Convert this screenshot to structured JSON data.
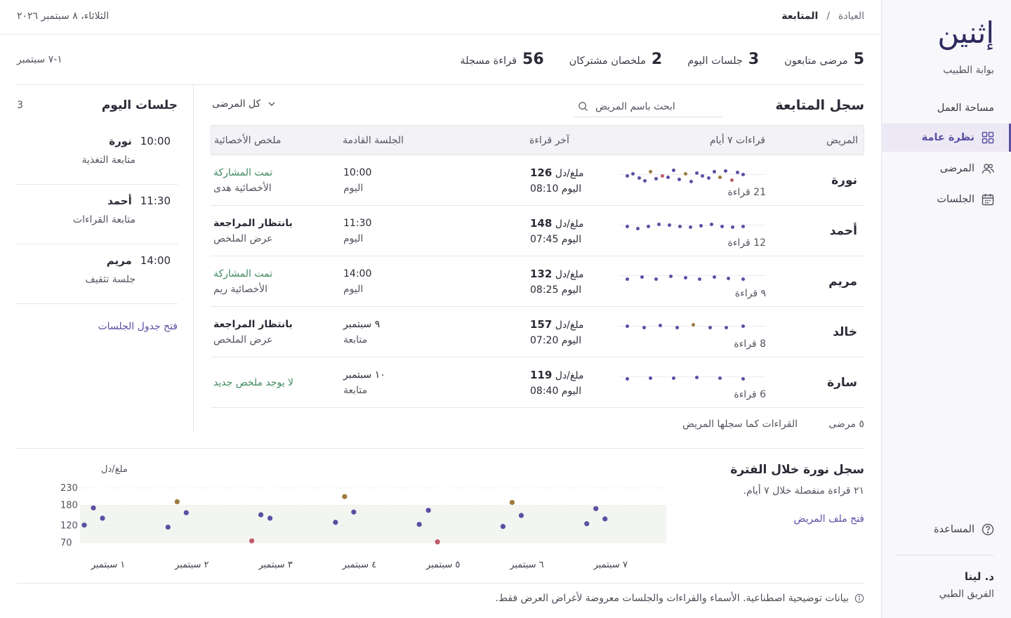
{
  "sidebar": {
    "logo": "إثنين",
    "portal": "بوابة الطبيب",
    "items": [
      {
        "label": "مساحة العمل",
        "icon": ""
      },
      {
        "label": "نظرة عامة",
        "icon": "grid-icon"
      },
      {
        "label": "المرضى",
        "icon": "users-icon"
      },
      {
        "label": "الجلسات",
        "icon": "calendar-icon"
      }
    ],
    "help": "المساعدة",
    "user_name": "د. لينا",
    "user_team": "الفريق الطبي"
  },
  "topbar": {
    "crumb_root": "العيادة",
    "crumb_sep": "/",
    "crumb_current": "المتابعة",
    "date": "الثلاثاء، ٨ سبتمبر ٢٠٢٦"
  },
  "stats": [
    {
      "n": "5",
      "label": "مرضى متابعون"
    },
    {
      "n": "3",
      "label": "جلسات اليوم"
    },
    {
      "n": "2",
      "label": "ملخصان مشتركان"
    },
    {
      "n": "56",
      "label": "قراءة مسجلة"
    }
  ],
  "range": "١-٧ سبتمبر",
  "log": {
    "title": "سجل المتابعة",
    "search_placeholder": "ابحث باسم المريض",
    "filter": "كل المرضى",
    "headers": [
      "المريض",
      "قراءات ٧ أيام",
      "آخر قراءة",
      "الجلسة القادمة",
      "ملخص الأخصائية"
    ],
    "rows": [
      {
        "name": "نورة",
        "count": "21 قراءة",
        "last_val": "126",
        "unit": "ملغ/دل",
        "last_time": "اليوم 08:10",
        "next_a": "10:00",
        "next_b": "اليوم",
        "sum_a": "تمت المشاركة",
        "sum_b": "الأخصائية هدى",
        "sum_status": "shared",
        "spark": [
          148,
          160,
          138,
          126,
          170,
          134,
          150,
          142,
          176,
          132,
          158,
          122,
          162,
          150,
          138,
          168,
          142,
          172,
          130,
          166,
          156
        ],
        "spark_colors": [
          "#5b4fa3",
          "#5b4fa3",
          "#5b4fa3",
          "#5b4fa3",
          "#9b7a3e",
          "#5b4fa3",
          "#c05a6a",
          "#5b4fa3",
          "#5b4fa3",
          "#5b4fa3",
          "#9b7a3e",
          "#5b4fa3",
          "#5b4fa3",
          "#5b4fa3",
          "#5b4fa3",
          "#5b4fa3",
          "#9b7a3e",
          "#5b4fa3",
          "#c05a6a",
          "#5b4fa3",
          "#5b4fa3"
        ]
      },
      {
        "name": "أحمد",
        "count": "12 قراءة",
        "last_val": "148",
        "unit": "ملغ/دل",
        "last_time": "اليوم 07:45",
        "next_a": "11:30",
        "next_b": "اليوم",
        "sum_a": "بانتظار المراجعة",
        "sum_b": "عرض الملخص",
        "sum_status": "pending",
        "spark": [
          150,
          140,
          150,
          160,
          155,
          148,
          145,
          152,
          160,
          150,
          145,
          150
        ],
        "spark_colors": [
          "#5b4fa3",
          "#5b4fa3",
          "#5b4fa3",
          "#5b4fa3",
          "#5b4fa3",
          "#5b4fa3",
          "#5b4fa3",
          "#5b4fa3",
          "#5b4fa3",
          "#5b4fa3",
          "#5b4fa3",
          "#5b4fa3"
        ]
      },
      {
        "name": "مريم",
        "count": "٩ قراءة",
        "last_val": "132",
        "unit": "ملغ/دل",
        "last_time": "اليوم 08:25",
        "next_a": "14:00",
        "next_b": "اليوم",
        "sum_a": "تمت المشاركة",
        "sum_b": "الأخصائية ريم",
        "sum_status": "shared",
        "spark": [
          140,
          150,
          140,
          152,
          145,
          140,
          148,
          142,
          140
        ],
        "spark_colors": [
          "#5b4fa3",
          "#5b4fa3",
          "#5b4fa3",
          "#5b4fa3",
          "#5b4fa3",
          "#5b4fa3",
          "#5b4fa3",
          "#5b4fa3",
          "#5b4fa3"
        ]
      },
      {
        "name": "خالد",
        "count": "8 قراءة",
        "last_val": "157",
        "unit": "ملغ/دل",
        "last_time": "اليوم 07:20",
        "next_a": "٩ سبتمبر",
        "next_b": "متابعة",
        "sum_a": "بانتظار المراجعة",
        "sum_b": "عرض الملخص",
        "sum_status": "pending",
        "spark": [
          155,
          148,
          158,
          150,
          162,
          150,
          148,
          155
        ],
        "spark_colors": [
          "#5b4fa3",
          "#5b4fa3",
          "#5b4fa3",
          "#5b4fa3",
          "#9b7a3e",
          "#5b4fa3",
          "#5b4fa3",
          "#5b4fa3"
        ]
      },
      {
        "name": "سارة",
        "count": "6 قراءة",
        "last_val": "119",
        "unit": "ملغ/دل",
        "last_time": "اليوم 08:40",
        "next_a": "١٠ سبتمبر",
        "next_b": "متابعة",
        "sum_a": "لا يوجد ملخص جديد",
        "sum_b": "",
        "sum_status": "none",
        "spark": [
          145,
          150,
          148,
          152,
          150,
          145
        ],
        "spark_colors": [
          "#5b4fa3",
          "#5b4fa3",
          "#5b4fa3",
          "#5b4fa3",
          "#5b4fa3",
          "#5b4fa3"
        ]
      }
    ],
    "footer_count": "٥ مرضى",
    "footer_note": "القراءات كما سجلها المريض"
  },
  "sessions": {
    "title": "جلسات اليوم",
    "count": "3",
    "items": [
      {
        "time": "10:00",
        "name": "نورة",
        "desc": "متابعة التغذية"
      },
      {
        "time": "11:30",
        "name": "أحمد",
        "desc": "متابعة القراءات"
      },
      {
        "time": "14:00",
        "name": "مريم",
        "desc": "جلسة تثقيف"
      }
    ],
    "link": "فتح جدول الجلسات"
  },
  "chart_panel": {
    "title": "سجل نورة خلال الفترة",
    "subtitle": "٢١ قراءة منفصلة خلال ٧ أيام.",
    "link": "فتح ملف المريض",
    "disclaimer": "بيانات توضيحية اصطناعية. الأسماء والقراءات والجلسات معروضة لأغراض العرض فقط."
  },
  "chart_data": {
    "type": "scatter",
    "ylabel": "ملغ/دل",
    "yticks": [
      70,
      120,
      180,
      230
    ],
    "ylim": [
      60,
      240
    ],
    "target_band": [
      70,
      180
    ],
    "categories": [
      "١ سبتمبر",
      "٢ سبتمبر",
      "٣ سبتمبر",
      "٤ سبتمبر",
      "٥ سبتمبر",
      "٦ سبتمبر",
      "٧ سبتمبر"
    ],
    "points": [
      {
        "day": 1,
        "slot": 0,
        "value": 122
      },
      {
        "day": 1,
        "slot": 1,
        "value": 172
      },
      {
        "day": 1,
        "slot": 2,
        "value": 142
      },
      {
        "day": 2,
        "slot": 0,
        "value": 116
      },
      {
        "day": 2,
        "slot": 1,
        "value": 190
      },
      {
        "day": 2,
        "slot": 2,
        "value": 158
      },
      {
        "day": 3,
        "slot": 0,
        "value": 76
      },
      {
        "day": 3,
        "slot": 1,
        "value": 152
      },
      {
        "day": 3,
        "slot": 2,
        "value": 142
      },
      {
        "day": 4,
        "slot": 0,
        "value": 130
      },
      {
        "day": 4,
        "slot": 1,
        "value": 205
      },
      {
        "day": 4,
        "slot": 2,
        "value": 160
      },
      {
        "day": 5,
        "slot": 0,
        "value": 124
      },
      {
        "day": 5,
        "slot": 1,
        "value": 165
      },
      {
        "day": 5,
        "slot": 2,
        "value": 73
      },
      {
        "day": 6,
        "slot": 0,
        "value": 118
      },
      {
        "day": 6,
        "slot": 1,
        "value": 188
      },
      {
        "day": 6,
        "slot": 2,
        "value": 150
      },
      {
        "day": 7,
        "slot": 0,
        "value": 126
      },
      {
        "day": 7,
        "slot": 1,
        "value": 170
      },
      {
        "day": 7,
        "slot": 2,
        "value": 140
      }
    ],
    "colors": {
      "normal": "#5b4fa3",
      "high": "#9b7a3e",
      "low": "#c05a6a",
      "band": "#f3f5f1"
    }
  }
}
